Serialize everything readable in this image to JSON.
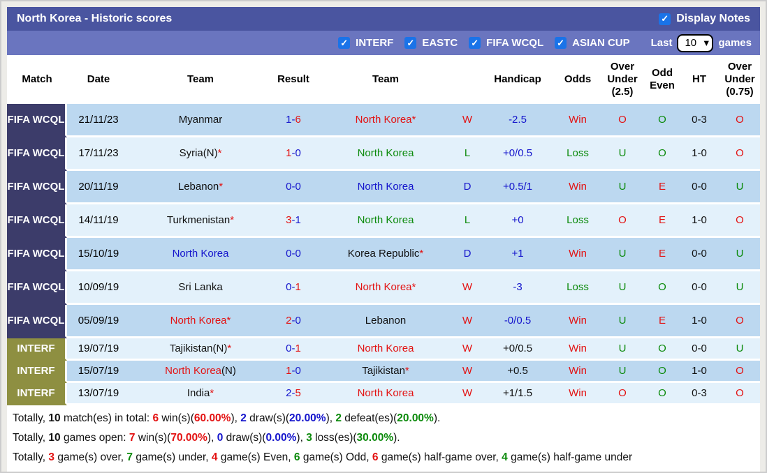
{
  "titlebar": {
    "title": "North Korea - Historic scores",
    "display_notes_label": "Display Notes",
    "display_notes_checked": true
  },
  "filterbar": {
    "filters": [
      {
        "label": "INTERF",
        "checked": true
      },
      {
        "label": "EASTC",
        "checked": true
      },
      {
        "label": "FIFA WCQL",
        "checked": true
      },
      {
        "label": "ASIAN CUP",
        "checked": true
      }
    ],
    "last_label": "Last",
    "last_games_value": "10",
    "games_label": "games"
  },
  "table": {
    "headers": [
      "Match",
      "Date",
      "Team",
      "Result",
      "Team",
      "",
      "Handicap",
      "Odds",
      "Over Under (2.5)",
      "Odd Even",
      "HT",
      "Over Under (0.75)"
    ],
    "rows": [
      {
        "competition": "FIFA WCQL",
        "type": "fifa",
        "shade": "dark",
        "date": "21/11/23",
        "home": [
          {
            "t": "Myanmar",
            "c": "black"
          }
        ],
        "score": [
          {
            "t": "1-",
            "c": "blue"
          },
          {
            "t": "6",
            "c": "red"
          }
        ],
        "away": [
          {
            "t": "North Korea*",
            "c": "red"
          }
        ],
        "wld": {
          "t": "W",
          "c": "red"
        },
        "handicap": {
          "t": "-2.5",
          "c": "blue"
        },
        "odds": {
          "t": "Win",
          "c": "red"
        },
        "ou25": {
          "t": "O",
          "c": "red"
        },
        "odd_even": {
          "t": "O",
          "c": "green"
        },
        "ht": {
          "t": "0-3",
          "c": "black"
        },
        "ou075": {
          "t": "O",
          "c": "red"
        }
      },
      {
        "competition": "FIFA WCQL",
        "type": "fifa",
        "shade": "light",
        "date": "17/11/23",
        "home": [
          {
            "t": "Syria(N)",
            "c": "black"
          },
          {
            "t": "*",
            "c": "red"
          }
        ],
        "score": [
          {
            "t": "1",
            "c": "red"
          },
          {
            "t": "-0",
            "c": "blue"
          }
        ],
        "away": [
          {
            "t": "North Korea",
            "c": "green"
          }
        ],
        "wld": {
          "t": "L",
          "c": "green"
        },
        "handicap": {
          "t": "+0/0.5",
          "c": "blue"
        },
        "odds": {
          "t": "Loss",
          "c": "green"
        },
        "ou25": {
          "t": "U",
          "c": "green"
        },
        "odd_even": {
          "t": "O",
          "c": "green"
        },
        "ht": {
          "t": "1-0",
          "c": "black"
        },
        "ou075": {
          "t": "O",
          "c": "red"
        }
      },
      {
        "competition": "FIFA WCQL",
        "type": "fifa",
        "shade": "dark",
        "date": "20/11/19",
        "home": [
          {
            "t": "Lebanon",
            "c": "black"
          },
          {
            "t": "*",
            "c": "red"
          }
        ],
        "score": [
          {
            "t": "0-0",
            "c": "blue"
          }
        ],
        "away": [
          {
            "t": "North Korea",
            "c": "blue"
          }
        ],
        "wld": {
          "t": "D",
          "c": "blue"
        },
        "handicap": {
          "t": "+0.5/1",
          "c": "blue"
        },
        "odds": {
          "t": "Win",
          "c": "red"
        },
        "ou25": {
          "t": "U",
          "c": "green"
        },
        "odd_even": {
          "t": "E",
          "c": "red"
        },
        "ht": {
          "t": "0-0",
          "c": "black"
        },
        "ou075": {
          "t": "U",
          "c": "green"
        }
      },
      {
        "competition": "FIFA WCQL",
        "type": "fifa",
        "shade": "light",
        "date": "14/11/19",
        "home": [
          {
            "t": "Turkmenistan",
            "c": "black"
          },
          {
            "t": "*",
            "c": "red"
          }
        ],
        "score": [
          {
            "t": "3",
            "c": "red"
          },
          {
            "t": "-1",
            "c": "blue"
          }
        ],
        "away": [
          {
            "t": "North Korea",
            "c": "green"
          }
        ],
        "wld": {
          "t": "L",
          "c": "green"
        },
        "handicap": {
          "t": "+0",
          "c": "blue"
        },
        "odds": {
          "t": "Loss",
          "c": "green"
        },
        "ou25": {
          "t": "O",
          "c": "red"
        },
        "odd_even": {
          "t": "E",
          "c": "red"
        },
        "ht": {
          "t": "1-0",
          "c": "black"
        },
        "ou075": {
          "t": "O",
          "c": "red"
        }
      },
      {
        "competition": "FIFA WCQL",
        "type": "fifa",
        "shade": "dark",
        "date": "15/10/19",
        "home": [
          {
            "t": "North Korea",
            "c": "blue"
          }
        ],
        "score": [
          {
            "t": "0-0",
            "c": "blue"
          }
        ],
        "away": [
          {
            "t": "Korea Republic",
            "c": "black"
          },
          {
            "t": "*",
            "c": "red"
          }
        ],
        "wld": {
          "t": "D",
          "c": "blue"
        },
        "handicap": {
          "t": "+1",
          "c": "blue"
        },
        "odds": {
          "t": "Win",
          "c": "red"
        },
        "ou25": {
          "t": "U",
          "c": "green"
        },
        "odd_even": {
          "t": "E",
          "c": "red"
        },
        "ht": {
          "t": "0-0",
          "c": "black"
        },
        "ou075": {
          "t": "U",
          "c": "green"
        }
      },
      {
        "competition": "FIFA WCQL",
        "type": "fifa",
        "shade": "light",
        "date": "10/09/19",
        "home": [
          {
            "t": "Sri Lanka",
            "c": "black"
          }
        ],
        "score": [
          {
            "t": "0-",
            "c": "blue"
          },
          {
            "t": "1",
            "c": "red"
          }
        ],
        "away": [
          {
            "t": "North Korea*",
            "c": "red"
          }
        ],
        "wld": {
          "t": "W",
          "c": "red"
        },
        "handicap": {
          "t": "-3",
          "c": "blue"
        },
        "odds": {
          "t": "Loss",
          "c": "green"
        },
        "ou25": {
          "t": "U",
          "c": "green"
        },
        "odd_even": {
          "t": "O",
          "c": "green"
        },
        "ht": {
          "t": "0-0",
          "c": "black"
        },
        "ou075": {
          "t": "U",
          "c": "green"
        }
      },
      {
        "competition": "FIFA WCQL",
        "type": "fifa",
        "shade": "dark",
        "date": "05/09/19",
        "home": [
          {
            "t": "North Korea*",
            "c": "red"
          }
        ],
        "score": [
          {
            "t": "2",
            "c": "red"
          },
          {
            "t": "-0",
            "c": "blue"
          }
        ],
        "away": [
          {
            "t": "Lebanon",
            "c": "black"
          }
        ],
        "wld": {
          "t": "W",
          "c": "red"
        },
        "handicap": {
          "t": "-0/0.5",
          "c": "blue"
        },
        "odds": {
          "t": "Win",
          "c": "red"
        },
        "ou25": {
          "t": "U",
          "c": "green"
        },
        "odd_even": {
          "t": "E",
          "c": "red"
        },
        "ht": {
          "t": "1-0",
          "c": "black"
        },
        "ou075": {
          "t": "O",
          "c": "red"
        }
      },
      {
        "competition": "INTERF",
        "type": "interf",
        "shade": "light",
        "date": "19/07/19",
        "home": [
          {
            "t": "Tajikistan(N)",
            "c": "black"
          },
          {
            "t": "*",
            "c": "red"
          }
        ],
        "score": [
          {
            "t": "0-",
            "c": "blue"
          },
          {
            "t": "1",
            "c": "red"
          }
        ],
        "away": [
          {
            "t": "North Korea",
            "c": "red"
          }
        ],
        "wld": {
          "t": "W",
          "c": "red"
        },
        "handicap": {
          "t": "+0/0.5",
          "c": "black"
        },
        "odds": {
          "t": "Win",
          "c": "red"
        },
        "ou25": {
          "t": "U",
          "c": "green"
        },
        "odd_even": {
          "t": "O",
          "c": "green"
        },
        "ht": {
          "t": "0-0",
          "c": "black"
        },
        "ou075": {
          "t": "U",
          "c": "green"
        }
      },
      {
        "competition": "INTERF",
        "type": "interf",
        "shade": "dark",
        "date": "15/07/19",
        "home": [
          {
            "t": "North Korea",
            "c": "red"
          },
          {
            "t": "(N)",
            "c": "black"
          }
        ],
        "score": [
          {
            "t": "1",
            "c": "red"
          },
          {
            "t": "-0",
            "c": "blue"
          }
        ],
        "away": [
          {
            "t": "Tajikistan",
            "c": "black"
          },
          {
            "t": "*",
            "c": "red"
          }
        ],
        "wld": {
          "t": "W",
          "c": "red"
        },
        "handicap": {
          "t": "+0.5",
          "c": "black"
        },
        "odds": {
          "t": "Win",
          "c": "red"
        },
        "ou25": {
          "t": "U",
          "c": "green"
        },
        "odd_even": {
          "t": "O",
          "c": "green"
        },
        "ht": {
          "t": "1-0",
          "c": "black"
        },
        "ou075": {
          "t": "O",
          "c": "red"
        }
      },
      {
        "competition": "INTERF",
        "type": "interf",
        "shade": "light",
        "date": "13/07/19",
        "home": [
          {
            "t": "India",
            "c": "black"
          },
          {
            "t": "*",
            "c": "red"
          }
        ],
        "score": [
          {
            "t": "2-",
            "c": "blue"
          },
          {
            "t": "5",
            "c": "red"
          }
        ],
        "away": [
          {
            "t": "North Korea",
            "c": "red"
          }
        ],
        "wld": {
          "t": "W",
          "c": "red"
        },
        "handicap": {
          "t": "+1/1.5",
          "c": "black"
        },
        "odds": {
          "t": "Win",
          "c": "red"
        },
        "ou25": {
          "t": "O",
          "c": "red"
        },
        "odd_even": {
          "t": "O",
          "c": "green"
        },
        "ht": {
          "t": "0-3",
          "c": "black"
        },
        "ou075": {
          "t": "O",
          "c": "red"
        }
      }
    ]
  },
  "summary": {
    "lines": [
      [
        {
          "t": "Totally, ",
          "c": "black"
        },
        {
          "t": "10",
          "c": "black",
          "b": true
        },
        {
          "t": " match(es) in total: ",
          "c": "black"
        },
        {
          "t": "6",
          "c": "red",
          "b": true
        },
        {
          "t": " win(s)(",
          "c": "black"
        },
        {
          "t": "60.00%",
          "c": "red",
          "b": true
        },
        {
          "t": "), ",
          "c": "black"
        },
        {
          "t": "2",
          "c": "blue",
          "b": true
        },
        {
          "t": " draw(s)(",
          "c": "black"
        },
        {
          "t": "20.00%",
          "c": "blue",
          "b": true
        },
        {
          "t": "), ",
          "c": "black"
        },
        {
          "t": "2",
          "c": "green",
          "b": true
        },
        {
          "t": " defeat(es)(",
          "c": "black"
        },
        {
          "t": "20.00%",
          "c": "green",
          "b": true
        },
        {
          "t": ").",
          "c": "black"
        }
      ],
      [
        {
          "t": "Totally, ",
          "c": "black"
        },
        {
          "t": "10",
          "c": "black",
          "b": true
        },
        {
          "t": " games open: ",
          "c": "black"
        },
        {
          "t": "7",
          "c": "red",
          "b": true
        },
        {
          "t": " win(s)(",
          "c": "black"
        },
        {
          "t": "70.00%",
          "c": "red",
          "b": true
        },
        {
          "t": "), ",
          "c": "black"
        },
        {
          "t": "0",
          "c": "blue",
          "b": true
        },
        {
          "t": " draw(s)(",
          "c": "black"
        },
        {
          "t": "0.00%",
          "c": "blue",
          "b": true
        },
        {
          "t": "), ",
          "c": "black"
        },
        {
          "t": "3",
          "c": "green",
          "b": true
        },
        {
          "t": " loss(es)(",
          "c": "black"
        },
        {
          "t": "30.00%",
          "c": "green",
          "b": true
        },
        {
          "t": ").",
          "c": "black"
        }
      ],
      [
        {
          "t": "Totally, ",
          "c": "black"
        },
        {
          "t": "3",
          "c": "red",
          "b": true
        },
        {
          "t": " game(s) over, ",
          "c": "black"
        },
        {
          "t": "7",
          "c": "green",
          "b": true
        },
        {
          "t": " game(s) under, ",
          "c": "black"
        },
        {
          "t": "4",
          "c": "red",
          "b": true
        },
        {
          "t": " game(s) Even, ",
          "c": "black"
        },
        {
          "t": "6",
          "c": "green",
          "b": true
        },
        {
          "t": " game(s) Odd, ",
          "c": "black"
        },
        {
          "t": "6",
          "c": "red",
          "b": true
        },
        {
          "t": " game(s) half-game over, ",
          "c": "black"
        },
        {
          "t": "4",
          "c": "green",
          "b": true
        },
        {
          "t": " game(s) half-game under",
          "c": "black"
        }
      ]
    ]
  },
  "colors": {
    "title_bar": "#4a55a0",
    "filter_bar": "#6a75bf",
    "fifa_label_bg": "#3c3c6a",
    "interf_label_bg": "#8e8f41",
    "row_dark": "#bcd8f0",
    "row_light": "#e3f1fb",
    "checkbox_blue": "#1a73e8",
    "win_red": "#e31212",
    "loss_green": "#0b8a0b",
    "draw_blue": "#1515cc"
  }
}
